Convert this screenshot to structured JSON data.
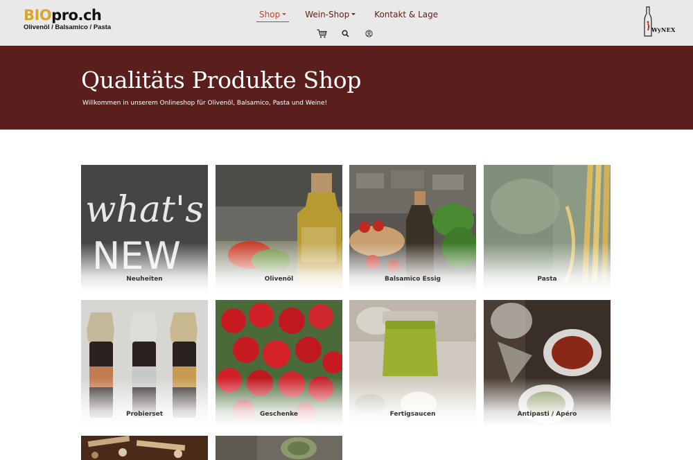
{
  "header": {
    "logo": {
      "part1": "BIO",
      "part2": "pro.ch",
      "tagline": "Olivenöl / Balsamico / Pasta"
    },
    "nav": [
      {
        "label": "Shop",
        "dropdown": true,
        "active": true
      },
      {
        "label": "Wein-Shop",
        "dropdown": true,
        "active": false
      },
      {
        "label": "Kontakt & Lage",
        "dropdown": false,
        "active": false
      }
    ],
    "icons": [
      "cart-icon",
      "search-icon",
      "account-icon"
    ],
    "partner_logo": "WyNEX"
  },
  "hero": {
    "title": "Qualitäts Produkte Shop",
    "subtitle": "Willkommen in unserem Onlineshop für Olivenöl, Balsamico, Pasta und Weine!"
  },
  "categories": [
    {
      "label": "Neuheiten",
      "chalk": "What's NEW"
    },
    {
      "label": "Olivenöl"
    },
    {
      "label": "Balsamico Essig"
    },
    {
      "label": "Pasta"
    },
    {
      "label": "Probierset"
    },
    {
      "label": "Geschenke"
    },
    {
      "label": "Fertigsaucen"
    },
    {
      "label": "Antipasti / Apéro"
    },
    {
      "label": ""
    },
    {
      "label": ""
    }
  ],
  "colors": {
    "hero_bg": "#5a1f1c",
    "header_bg": "#e9e9e9",
    "nav_text": "#5a1f1a",
    "nav_active": "#b5473a",
    "logo_gold": "#d8a82a"
  }
}
